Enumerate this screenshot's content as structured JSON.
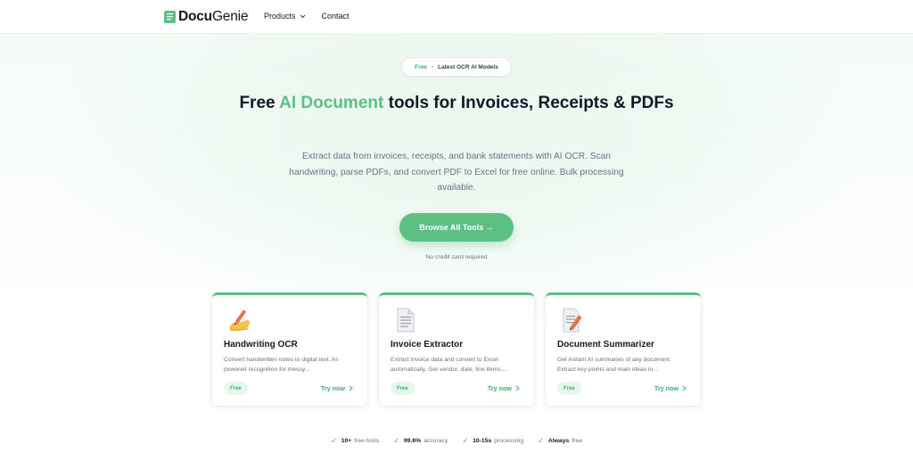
{
  "header": {
    "logo_bold": "Docu",
    "logo_light": "Genie",
    "nav": [
      {
        "label": "Products"
      },
      {
        "label": "Contact"
      }
    ]
  },
  "badge": {
    "free": "Free",
    "separator": "•",
    "text": "Latest OCR AI Models"
  },
  "hero": {
    "title_pre": "Free ",
    "title_accent": "AI Document",
    "title_post": " tools for Invoices, Receipts & PDFs",
    "description": "Extract data from invoices, receipts, and bank statements with AI OCR. Scan handwriting, parse PDFs, and convert PDF to Excel for free online. Bulk processing available.",
    "cta_label": "Browse All Tools →",
    "cta_note": "No credit card required"
  },
  "cards": [
    {
      "title": "Handwriting OCR",
      "description": "Convert handwritten notes to digital text. AI-powered recognition for messy...",
      "badge": "Free",
      "link": "Try now",
      "icon": "writing-hand-icon"
    },
    {
      "title": "Invoice Extractor",
      "description": "Extract invoice data and convert to Excel automatically. Get vendor, date, line items,...",
      "badge": "Free",
      "link": "Try now",
      "icon": "document-icon"
    },
    {
      "title": "Document Summarizer",
      "description": "Get instant AI summaries of any document. Extract key points and main ideas in...",
      "badge": "Free",
      "link": "Try now",
      "icon": "document-pencil-icon"
    }
  ],
  "stats": [
    {
      "check": "✓",
      "value": "10+",
      "label": "free tools"
    },
    {
      "check": "✓",
      "value": "99.6%",
      "label": "accuracy"
    },
    {
      "check": "✓",
      "value": "10-15s",
      "label": "processing"
    },
    {
      "check": "✓",
      "value": "Always",
      "label": "free"
    }
  ],
  "colors": {
    "accent": "#5cbf83",
    "accent_dark": "#3fae6b",
    "badge_bg": "#e8f6ee",
    "text_dark": "#111827",
    "text_muted": "#6b7280"
  }
}
